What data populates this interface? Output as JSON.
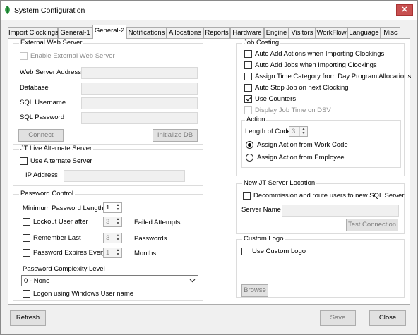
{
  "window": {
    "title": "System Configuration",
    "close_glyph": "✕"
  },
  "tabs": [
    "Import Clockings",
    "General-1",
    "General-2",
    "Notifications",
    "Allocations",
    "Reports",
    "Hardware",
    "Engine",
    "Visitors",
    "WorkFlow",
    "Language",
    "Misc"
  ],
  "active_tab": "General-2",
  "external_web": {
    "legend": "External Web Server",
    "enable_label": "Enable External Web Server",
    "address_label": "Web Server Address",
    "database_label": "Database",
    "sql_user_label": "SQL Username",
    "sql_pass_label": "SQL Password",
    "connect_label": "Connect",
    "initialize_label": "Initialize DB"
  },
  "jt_live": {
    "legend": "JT Live Alternate Server",
    "use_alt_label": "Use Alternate Server",
    "ip_label": "IP Address"
  },
  "password_control": {
    "legend": "Password Control",
    "min_length_label": "Minimum Password Length",
    "min_length_value": "1",
    "lockout_label": "Lockout User after",
    "lockout_value": "3",
    "lockout_suffix": "Failed Attempts",
    "remember_label": "Remember Last",
    "remember_value": "3",
    "remember_suffix": "Passwords",
    "expires_label": "Password Expires Every",
    "expires_value": "1",
    "expires_suffix": "Months",
    "complexity_label": "Password Complexity Level",
    "complexity_value": "0 - None",
    "windows_logon_label": "Logon using Windows User name"
  },
  "job_costing": {
    "legend": "Job Costing",
    "options": [
      {
        "label": "Auto Add Actions when Importing Clockings",
        "checked": false,
        "enabled": true
      },
      {
        "label": "Auto Add Jobs when Importing Clockings",
        "checked": false,
        "enabled": true
      },
      {
        "label": "Assign Time Category from Day Program Allocations",
        "checked": false,
        "enabled": true
      },
      {
        "label": "Auto Stop Job on next Clocking",
        "checked": false,
        "enabled": true
      },
      {
        "label": "Use Counters",
        "checked": true,
        "enabled": true
      },
      {
        "label": "Display Job Time on DSV",
        "checked": false,
        "enabled": false
      }
    ],
    "action_legend": "Action",
    "length_label": "Length of Code",
    "length_value": "3",
    "assign_work_code_label": "Assign Action from Work Code",
    "assign_employee_label": "Assign Action from Employee",
    "selected_assign": "work_code"
  },
  "new_server": {
    "legend": "New JT Server Location",
    "decommission_label": "Decommission and route users to new SQL Server",
    "server_name_label": "Server Name",
    "test_label": "Test Connection"
  },
  "custom_logo": {
    "legend": "Custom Logo",
    "use_label": "Use Custom Logo",
    "browse_label": "Browse"
  },
  "footer": {
    "refresh_label": "Refresh",
    "save_label": "Save",
    "close_label": "Close"
  },
  "colors": {
    "close_button": "#c75050",
    "app_icon": "#2e9b43",
    "window_bg": "#f0f0f0",
    "panel_bg": "#ffffff"
  },
  "icons": {
    "app": "app-leaf-icon",
    "close": "close-icon",
    "dropdown": "chevron-down-icon"
  }
}
